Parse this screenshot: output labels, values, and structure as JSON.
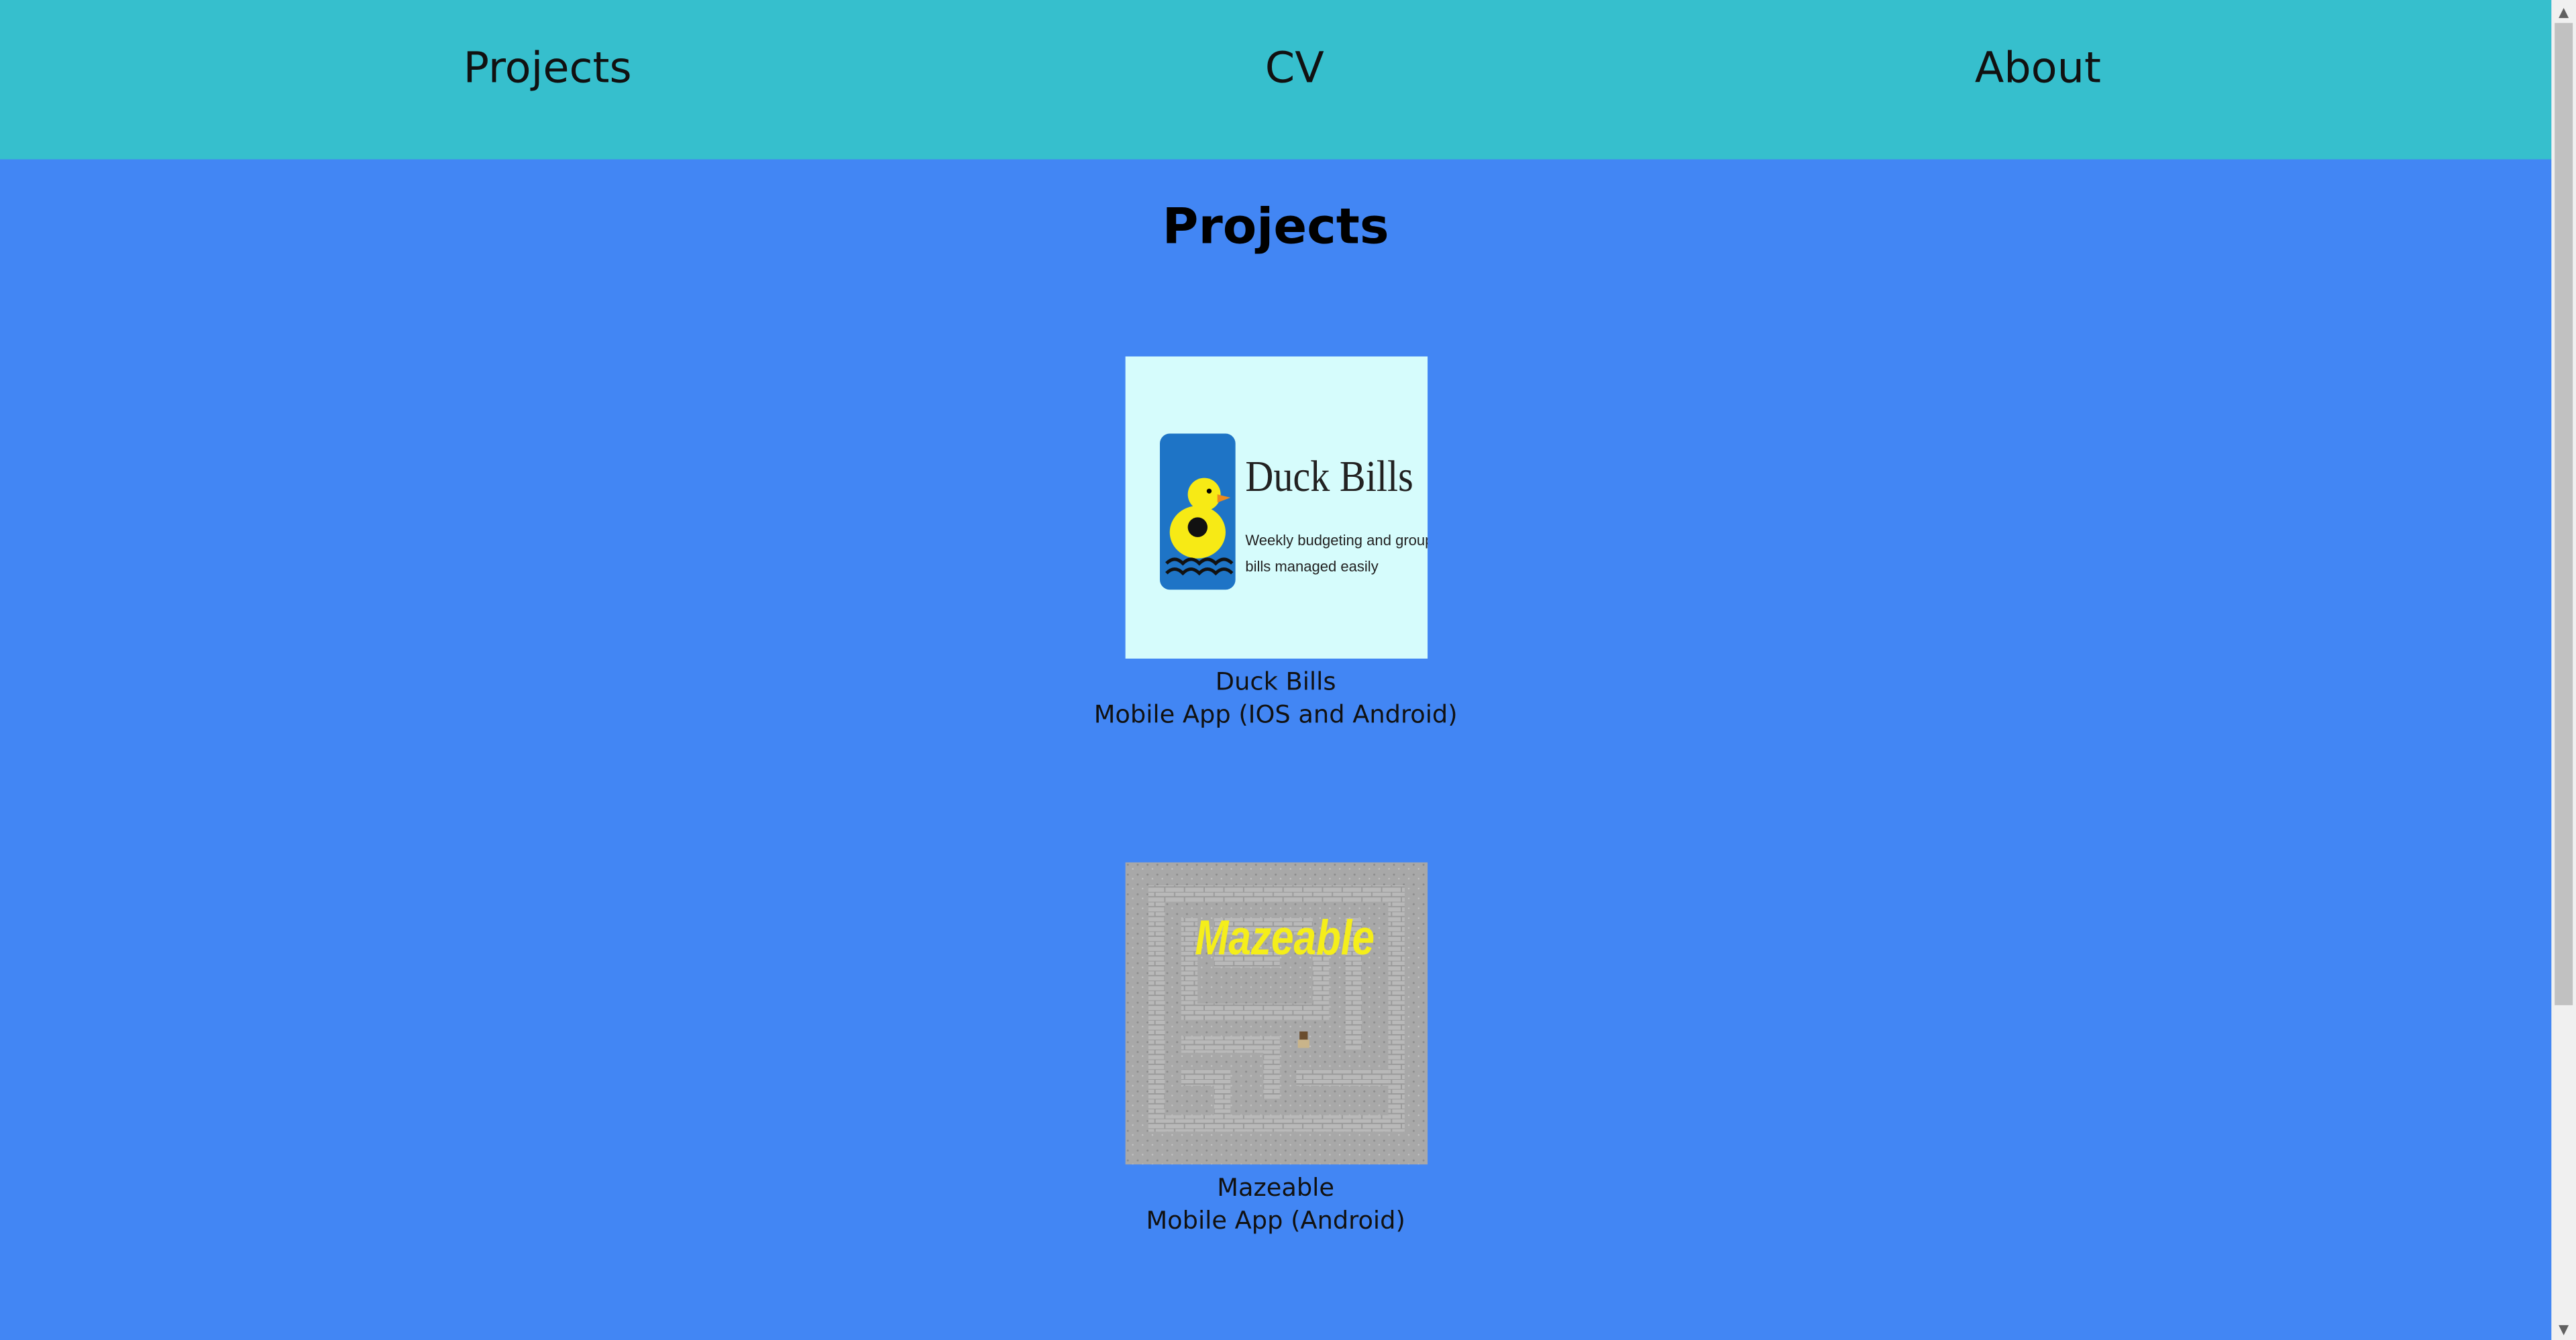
{
  "nav": {
    "items": [
      {
        "label": "Projects"
      },
      {
        "label": "CV"
      },
      {
        "label": "About"
      }
    ]
  },
  "main": {
    "title": "Projects",
    "projects": [
      {
        "name": "Duck Bills",
        "subtitle": "Mobile App (IOS and Android)",
        "thumb_title": "Duck Bills",
        "thumb_tagline_1": "Weekly budgeting and group",
        "thumb_tagline_2": "bills managed easily"
      },
      {
        "name": "Mazeable",
        "subtitle": "Mobile App (Android)",
        "thumb_title": "Mazeable"
      }
    ]
  },
  "colors": {
    "navbar": "#36bfcd",
    "background": "#4286f4"
  },
  "scrollbar": {
    "up_icon": "triangle-up",
    "down_icon": "triangle-down"
  }
}
